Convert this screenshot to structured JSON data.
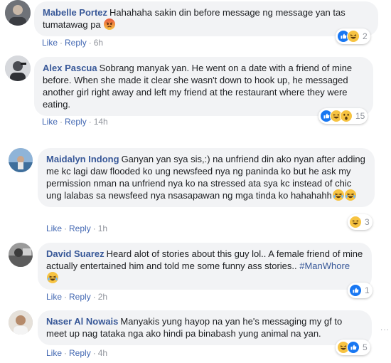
{
  "comments": [
    {
      "author": "Mabelle Portez",
      "text": "Hahahaha sakin din before message ng message yan tas tumatawag pa",
      "trailing_emoji": [
        "angry-face"
      ],
      "actions": {
        "like": "Like",
        "reply": "Reply",
        "time": "6h"
      },
      "reactions": {
        "icons": [
          "like",
          "laugh"
        ],
        "count": "2"
      }
    },
    {
      "author": "Alex Pascua",
      "text": "Sobrang manyak yan. He went on a date with a friend of mine before. When she made it clear she wasn't down to hook up, he messaged another girl right away and left my friend at the restaurant where they were eating.",
      "actions": {
        "like": "Like",
        "reply": "Reply",
        "time": "14h"
      },
      "reactions": {
        "icons": [
          "like",
          "laugh",
          "wow"
        ],
        "count": "15"
      }
    },
    {
      "author": "Maidalyn Indong",
      "text": "Ganyan yan sya sis,:) na unfriend din ako nyan after adding me kc lagi daw flooded ko ung newsfeed nya ng paninda ko but he ask my permission nman na unfriend nya ko na stressed ata sya kc instead of chic ung lalabas sa newsfeed nya nsasapawan ng mga tinda ko hahahahh",
      "trailing_emoji": [
        "laughing-face",
        "laughing-face"
      ],
      "actions": {
        "like": "Like",
        "reply": "Reply",
        "time": "1h"
      },
      "reactions": {
        "icons": [
          "laugh"
        ],
        "count": "3"
      }
    },
    {
      "author": "David Suarez",
      "text": "Heard alot of stories about this guy lol.. A female friend of mine actually entertained him and told me some funny ass stories..",
      "hashtag": "#ManWhore",
      "trailing_emoji": [
        "laughing-face"
      ],
      "actions": {
        "like": "Like",
        "reply": "Reply",
        "time": "2h"
      },
      "reactions": {
        "icons": [
          "like"
        ],
        "count": "1"
      }
    },
    {
      "author": "Naser Al Nowais",
      "text": "Manyakis yung hayop na yan he's messaging my gf to meet up nag tataka nga ako hindi pa binabash yung animal na yan.",
      "actions": {
        "like": "Like",
        "reply": "Reply",
        "time": "4h"
      },
      "reactions": {
        "icons": [
          "laugh",
          "like"
        ],
        "count": "5"
      }
    }
  ],
  "colors": {
    "name": "#385898",
    "link": "#4267b2",
    "meta": "#90949c",
    "bubble": "#f2f3f5",
    "like_blue": "#1877f2",
    "emoji_yellow": "#f7c341",
    "angry_red": "#e9573f"
  }
}
